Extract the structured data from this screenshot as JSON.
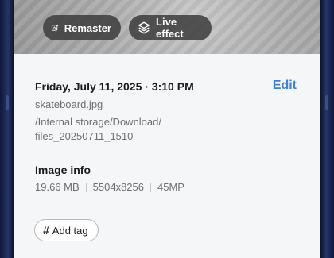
{
  "photo_actions": [
    {
      "label": "Remaster",
      "icon": "sparkle-image-icon"
    },
    {
      "label": "Live effect",
      "icon": "layers-icon"
    }
  ],
  "details": {
    "datetime": "Friday, July 11, 2025 · 3:10 PM",
    "edit_label": "Edit",
    "file_name": "skateboard.jpg",
    "file_path": "/Internal storage/Download/ files_20250711_1510"
  },
  "image_info": {
    "title": "Image info",
    "size": "19.66 MB",
    "resolution": "5504x8256",
    "megapixels": "45MP"
  },
  "tags": {
    "add_label": "Add tag",
    "icon": "hash-icon"
  },
  "colors": {
    "accent": "#3f7fd6",
    "sheet_bg": "#f5f6f8",
    "device_frame": "#1c2a52"
  }
}
